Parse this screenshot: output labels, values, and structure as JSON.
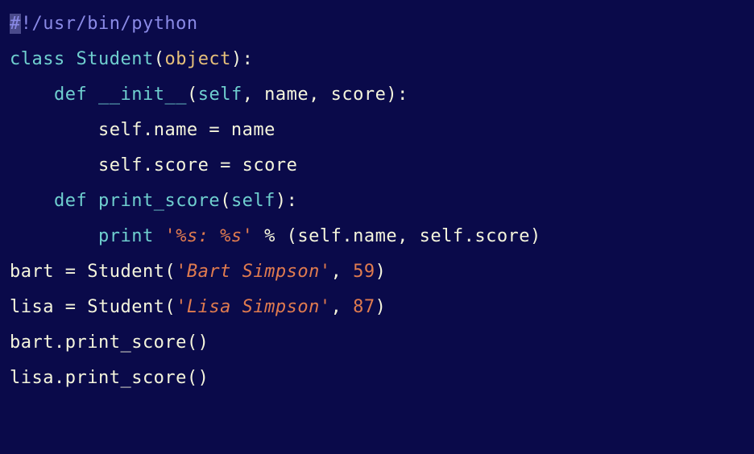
{
  "code": {
    "line1": {
      "shebang_selected": "#",
      "shebang_rest": "!/usr/bin/python"
    },
    "line2": {
      "kw_class": "class",
      "sp1": " ",
      "classname": "Student",
      "lparen": "(",
      "builtin_object": "object",
      "rparen_colon": "):"
    },
    "line3": {
      "indent": "    ",
      "kw_def": "def",
      "sp1": " ",
      "funcname": "__init__",
      "lparen": "(",
      "param_self": "self",
      "rest_params": ", name, score):"
    },
    "line4": {
      "indent": "        ",
      "text": "self.name = name"
    },
    "line5": {
      "indent": "        ",
      "text": "self.score = score"
    },
    "line6": {
      "indent": "    ",
      "kw_def": "def",
      "sp1": " ",
      "funcname": "print_score",
      "lparen": "(",
      "param_self": "self",
      "rparen_colon": "):"
    },
    "line7": {
      "indent": "        ",
      "kw_print": "print",
      "sp1": " ",
      "string": "'%s: %s'",
      "rest": " % (self.name, self.score)"
    },
    "line8": {
      "assign": "bart = Student(",
      "string": "'Bart Simpson'",
      "comma": ", ",
      "number": "59",
      "rparen": ")"
    },
    "line9": {
      "assign": "lisa = Student(",
      "string": "'Lisa Simpson'",
      "comma": ", ",
      "number": "87",
      "rparen": ")"
    },
    "line10": {
      "text": "bart.print_score()"
    },
    "line11": {
      "text": "lisa.print_score()"
    }
  }
}
